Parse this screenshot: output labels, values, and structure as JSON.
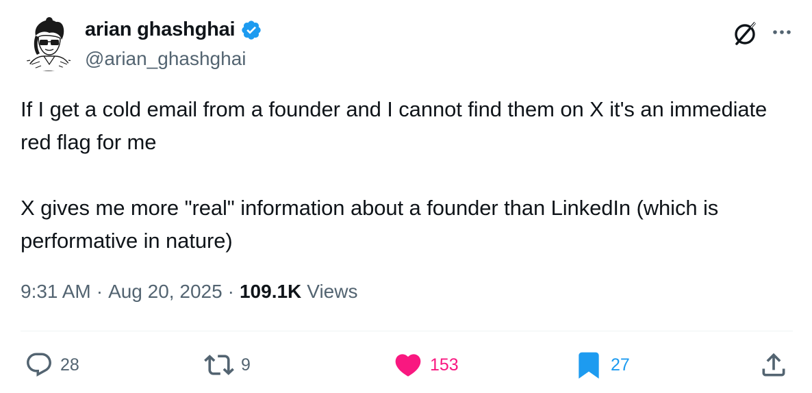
{
  "author": {
    "display_name": "arian ghashghai",
    "handle": "@arian_ghashghai",
    "verified": true,
    "verified_color": "#1d9bf0"
  },
  "tweet": {
    "paragraphs": [
      "If I get a cold email from a founder and I cannot find them on X it's an immediate red flag for me",
      "X gives me more \"real\" information about a founder than LinkedIn (which is performative in nature)"
    ],
    "time": "9:31 AM",
    "separator": "·",
    "date": "Aug 20, 2025",
    "views_count": "109.1K",
    "views_label": "Views"
  },
  "actions": {
    "replies": "28",
    "reposts": "9",
    "likes": "153",
    "bookmarks": "27",
    "like_color": "#f91880",
    "bookmark_color": "#1d9bf0"
  },
  "icons": [
    "avatar",
    "verified-badge-icon",
    "grok-icon",
    "more-icon",
    "reply-icon",
    "repost-icon",
    "like-icon",
    "bookmark-icon",
    "share-icon"
  ]
}
